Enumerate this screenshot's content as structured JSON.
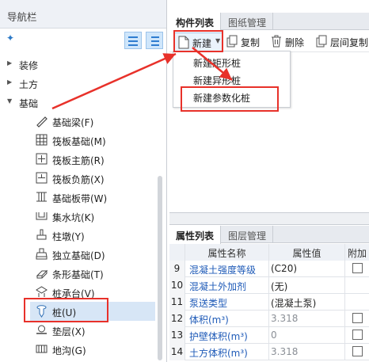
{
  "nav": {
    "title": "导航栏",
    "groups": [
      {
        "label": "装修",
        "expanded": false
      },
      {
        "label": "土方",
        "expanded": false
      },
      {
        "label": "基础",
        "expanded": true
      }
    ],
    "items": [
      {
        "label": "基础梁(F)",
        "icon": "beam-icon"
      },
      {
        "label": "筏板基础(M)",
        "icon": "raft-grid-icon"
      },
      {
        "label": "筏板主筋(R)",
        "icon": "main-rebar-icon"
      },
      {
        "label": "筏板负筋(X)",
        "icon": "negative-rebar-icon"
      },
      {
        "label": "基础板带(W)",
        "icon": "slab-strip-icon"
      },
      {
        "label": "集水坑(K)",
        "icon": "sump-pit-icon"
      },
      {
        "label": "柱墩(Y)",
        "icon": "column-pier-icon"
      },
      {
        "label": "独立基础(D)",
        "icon": "isolated-footing-icon"
      },
      {
        "label": "条形基础(T)",
        "icon": "strip-footing-icon"
      },
      {
        "label": "桩承台(V)",
        "icon": "pile-cap-icon"
      },
      {
        "label": "桩(U)",
        "icon": "pile-icon",
        "selected": true
      },
      {
        "label": "垫层(X)",
        "icon": "cushion-icon"
      },
      {
        "label": "地沟(G)",
        "icon": "trench-icon"
      }
    ]
  },
  "component_panel": {
    "tabs": [
      {
        "label": "构件列表",
        "active": true
      },
      {
        "label": "图纸管理",
        "active": false
      }
    ],
    "toolbar": {
      "new_label": "新建",
      "copy_label": "复制",
      "delete_label": "删除",
      "interlayer_copy_label": "层间复制"
    },
    "new_menu": [
      "新建矩形桩",
      "新建异形桩",
      "新建参数化桩"
    ]
  },
  "property_panel": {
    "tabs": [
      {
        "label": "属性列表",
        "active": true
      },
      {
        "label": "图层管理",
        "active": false
      }
    ],
    "columns": [
      "属性名称",
      "属性值",
      "附加"
    ],
    "rows": [
      {
        "num": "9",
        "name": "混凝土强度等级",
        "value": "(C20)",
        "name_color": "blue",
        "value_color": "black",
        "checkbox": true
      },
      {
        "num": "10",
        "name": "混凝土外加剂",
        "value": "(无)",
        "name_color": "blue",
        "value_color": "black",
        "checkbox": false
      },
      {
        "num": "11",
        "name": "泵送类型",
        "value": "(混凝土泵)",
        "name_color": "blue",
        "value_color": "black",
        "checkbox": false
      },
      {
        "num": "12",
        "name": "体积(m³)",
        "value": "3.318",
        "name_color": "blue",
        "value_color": "grey",
        "checkbox": true
      },
      {
        "num": "13",
        "name": "护壁体积(m³)",
        "value": "0",
        "name_color": "blue",
        "value_color": "grey",
        "checkbox": true
      },
      {
        "num": "14",
        "name": "土方体积(m³)",
        "value": "3.318",
        "name_color": "blue",
        "value_color": "grey",
        "checkbox": true
      }
    ]
  },
  "colors": {
    "annotation": "#e8312a",
    "link_blue": "#1f5bb8",
    "selected_row": "#d7e6f6",
    "header_bg": "#eef1f6"
  }
}
